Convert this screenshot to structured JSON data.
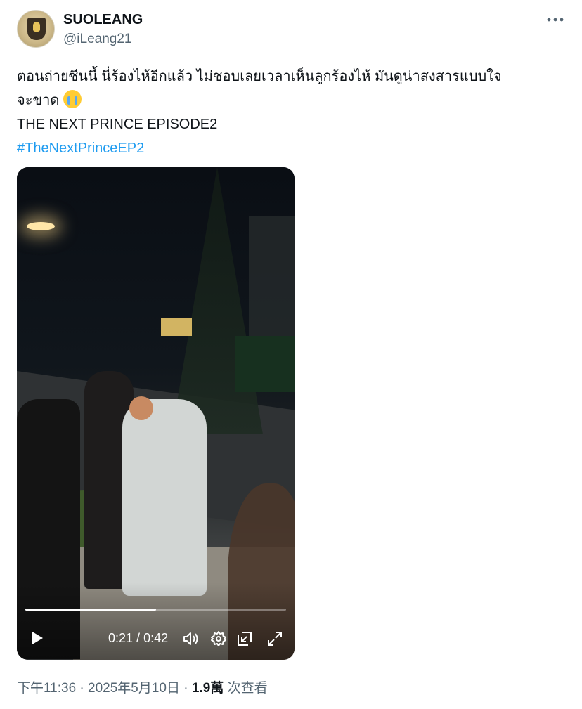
{
  "author": {
    "display_name": "SUOLEANG",
    "handle": "@iLeang21"
  },
  "tweet": {
    "line1": "ตอนถ่ายซีนนี้ นี่ร้องไห้อีกแล้ว ไม่ชอบเลยเวลาเห็นลูกร้องไห้ มันดูน่าสงสารแบบใจ",
    "line2": "จะขาด",
    "line3": "THE NEXT PRINCE EPISODE2",
    "hashtag": "#TheNextPrinceEP2",
    "emoji_icon": "loudly-crying-face-icon"
  },
  "video": {
    "current_time": "0:21",
    "separator": " / ",
    "duration": "0:42",
    "progress": 0.5
  },
  "meta": {
    "time": "下午11:36",
    "dot1": " · ",
    "date": "2025年5月10日",
    "dot2": " · ",
    "views_count": "1.9萬",
    "views_label": " 次查看"
  },
  "colors": {
    "link": "#1d9bf0",
    "text": "#0f1419",
    "secondary": "#536471"
  }
}
